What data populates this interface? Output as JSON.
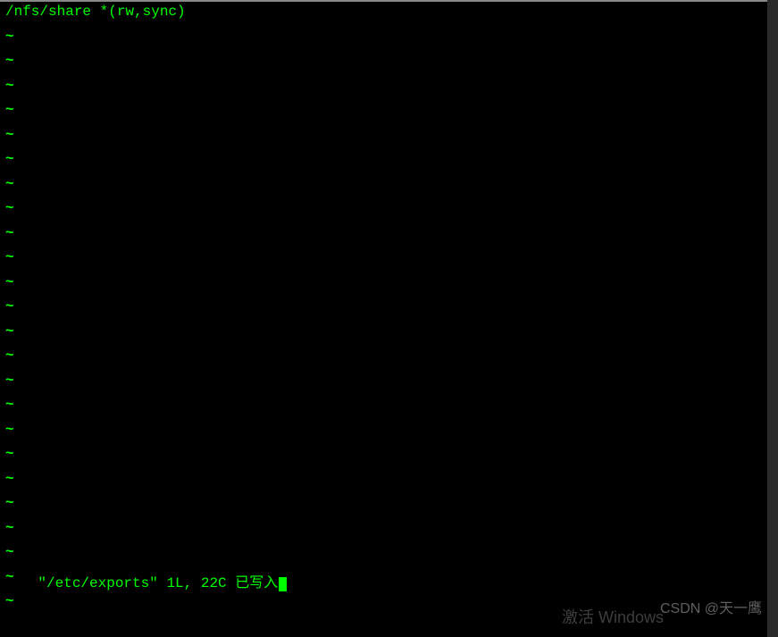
{
  "editor": {
    "content_line": "/nfs/share *(rw,sync)",
    "tilde_char": "~",
    "tilde_count": 24,
    "status": {
      "filename": "\"/etc/exports\"",
      "position": "1L, 22C",
      "message": "已写入"
    }
  },
  "watermarks": {
    "activate": "激活 Windows",
    "csdn": "CSDN @天一鹰"
  }
}
